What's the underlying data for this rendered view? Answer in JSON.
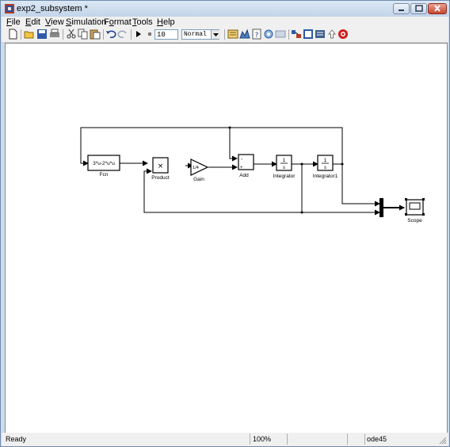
{
  "window": {
    "title": "exp2_subsystem *"
  },
  "menu": [
    {
      "label": "File",
      "u": "F",
      "rest": "ile"
    },
    {
      "label": "Edit",
      "u": "E",
      "rest": "dit"
    },
    {
      "label": "View",
      "u": "V",
      "rest": "iew"
    },
    {
      "label": "Simulation",
      "u": "S",
      "rest": "imulation"
    },
    {
      "label": "Format",
      "pre": "F",
      "u": "o",
      "rest": "rmat"
    },
    {
      "label": "Tools",
      "u": "T",
      "rest": "ools"
    },
    {
      "label": "Help",
      "u": "H",
      "rest": "elp"
    }
  ],
  "toolbar": {
    "stop_time": "10",
    "sim_mode": "Normal",
    "icons": [
      "new-file-icon",
      "open-folder-icon",
      "save-icon",
      "print-icon",
      "cut-icon",
      "copy-icon",
      "paste-icon",
      "undo-icon",
      "redo-icon",
      "play-icon",
      "stop-icon",
      "build-icon",
      "update-diagram-icon",
      "model-explorer-icon",
      "library-browser-icon",
      "debugger-icon",
      "go-to-parent-icon",
      "help-icon"
    ]
  },
  "diagram": {
    "blocks": {
      "fcn": {
        "expr": "3*u-2*u*u",
        "label": "Fcn"
      },
      "product": {
        "symbol": "×",
        "label": "Product"
      },
      "gain": {
        "value": "1/4",
        "label": "Gain"
      },
      "add": {
        "label": "Add",
        "sign_top": "-",
        "sign_bottom": "+"
      },
      "integrator": {
        "num": "1",
        "den": "s",
        "label": "Integrator"
      },
      "integrator1": {
        "num": "1",
        "den": "s",
        "label": "Integrator1"
      },
      "scope": {
        "label": "Scope"
      }
    }
  },
  "status": {
    "state": "Ready",
    "zoom": "100%",
    "solver": "ode45"
  }
}
